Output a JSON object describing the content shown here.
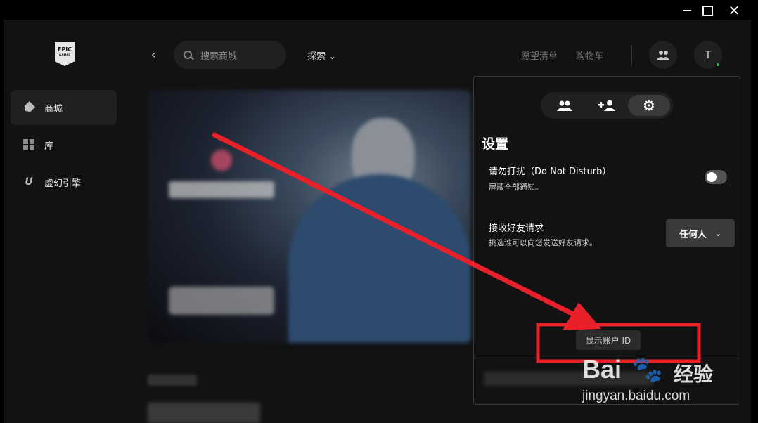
{
  "window": {
    "close_glyph": "✕"
  },
  "sidebar": {
    "logo_line1": "EPIC",
    "logo_line2": "GAMES",
    "items": [
      {
        "label": "商城",
        "icon": "tag-icon",
        "active": true
      },
      {
        "label": "库",
        "icon": "grid-icon",
        "active": false
      },
      {
        "label": "虚幻引擎",
        "icon": "unreal-engine-icon",
        "active": false
      }
    ]
  },
  "header": {
    "back_glyph": "‹",
    "search_placeholder": "搜索商城",
    "explore_label": "探索",
    "explore_chevron": "⌄",
    "wishlist_label": "愿望清单",
    "cart_label": "购物车",
    "avatar_initial": "T",
    "online_status_color": "#3fbf5f"
  },
  "panel": {
    "tabs": [
      {
        "icon": "friends-icon",
        "glyph": "👥",
        "active": false
      },
      {
        "icon": "add-friend-icon",
        "glyph": "+👤",
        "active": false
      },
      {
        "icon": "gear-icon",
        "glyph": "⚙",
        "active": true
      }
    ],
    "title": "设置",
    "dnd": {
      "title": "请勿打扰（Do Not Disturb）",
      "subtitle": "屏蔽全部通知。",
      "enabled": false
    },
    "friend_requests": {
      "title": "接收好友请求",
      "subtitle": "挑选谁可以向您发送好友请求。",
      "selected": "任何人",
      "chevron": "⌄"
    },
    "show_id_label": "显示账户 ID"
  },
  "annotation": {
    "arrow_color": "#e8202a",
    "highlight_color": "#e8202a"
  },
  "watermark": {
    "brand": "Bai",
    "brand_suffix": "经验",
    "url": "jingyan.baidu.com"
  }
}
